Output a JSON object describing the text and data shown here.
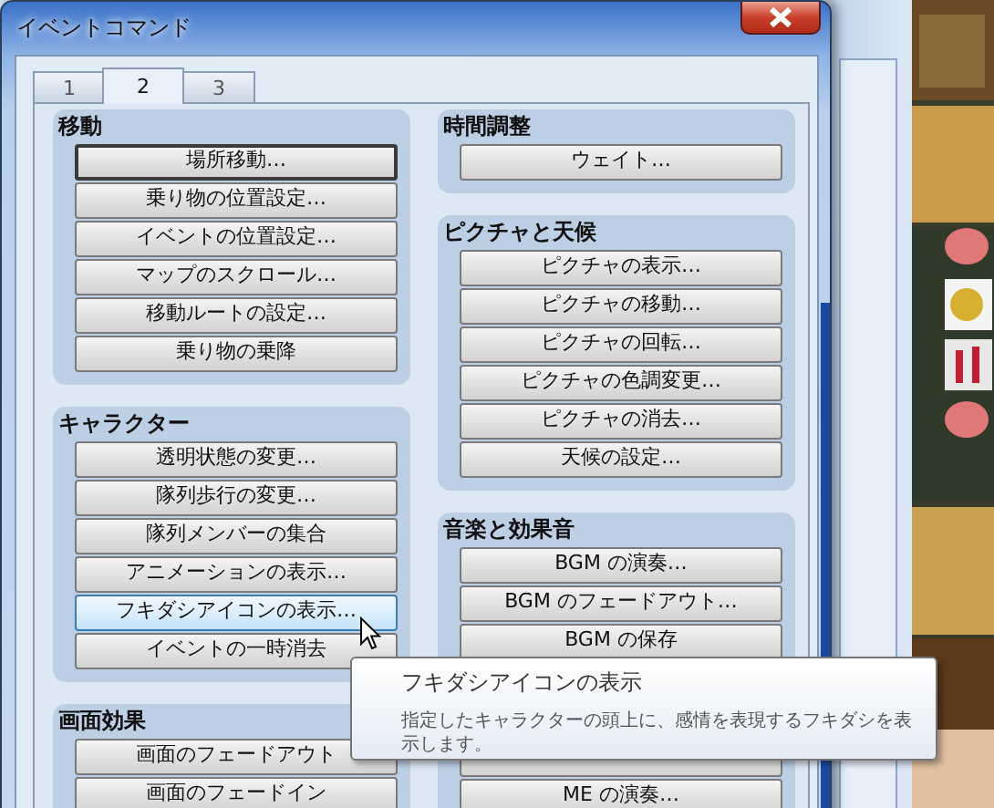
{
  "window": {
    "title": "イベントコマンド"
  },
  "tabs": [
    {
      "label": "1",
      "selected": false
    },
    {
      "label": "2",
      "selected": true
    },
    {
      "label": "3",
      "selected": false
    }
  ],
  "left_groups": [
    {
      "title": "移動",
      "buttons": [
        {
          "kind": "command",
          "label": "場所移動…",
          "focused": true,
          "hovered": false
        },
        {
          "kind": "command",
          "label": "乗り物の位置設定…",
          "focused": false,
          "hovered": false
        },
        {
          "kind": "command",
          "label": "イベントの位置設定…",
          "focused": false,
          "hovered": false
        },
        {
          "kind": "command",
          "label": "マップのスクロール…",
          "focused": false,
          "hovered": false
        },
        {
          "kind": "command",
          "label": "移動ルートの設定…",
          "focused": false,
          "hovered": false
        },
        {
          "kind": "command",
          "label": "乗り物の乗降",
          "focused": false,
          "hovered": false
        }
      ]
    },
    {
      "title": "キャラクター",
      "buttons": [
        {
          "kind": "command",
          "label": "透明状態の変更…",
          "focused": false,
          "hovered": false
        },
        {
          "kind": "command",
          "label": "隊列歩行の変更…",
          "focused": false,
          "hovered": false
        },
        {
          "kind": "command",
          "label": "隊列メンバーの集合",
          "focused": false,
          "hovered": false
        },
        {
          "kind": "command",
          "label": "アニメーションの表示…",
          "focused": false,
          "hovered": false
        },
        {
          "kind": "command",
          "label": "フキダシアイコンの表示…",
          "focused": false,
          "hovered": true
        },
        {
          "kind": "command",
          "label": "イベントの一時消去",
          "focused": false,
          "hovered": false
        }
      ]
    },
    {
      "title": "画面効果",
      "buttons": [
        {
          "kind": "command",
          "label": "画面のフェードアウト",
          "focused": false,
          "hovered": false
        },
        {
          "kind": "command",
          "label": "画面のフェードイン",
          "focused": false,
          "hovered": false
        }
      ]
    }
  ],
  "right_groups": [
    {
      "title": "時間調整",
      "buttons": [
        {
          "kind": "command",
          "label": "ウェイト…",
          "focused": false,
          "hovered": false
        }
      ]
    },
    {
      "title": "ピクチャと天候",
      "buttons": [
        {
          "kind": "command",
          "label": "ピクチャの表示…",
          "focused": false,
          "hovered": false
        },
        {
          "kind": "command",
          "label": "ピクチャの移動…",
          "focused": false,
          "hovered": false
        },
        {
          "kind": "command",
          "label": "ピクチャの回転…",
          "focused": false,
          "hovered": false
        },
        {
          "kind": "command",
          "label": "ピクチャの色調変更…",
          "focused": false,
          "hovered": false
        },
        {
          "kind": "command",
          "label": "ピクチャの消去…",
          "focused": false,
          "hovered": false
        },
        {
          "kind": "command",
          "label": "天候の設定…",
          "focused": false,
          "hovered": false
        }
      ]
    },
    {
      "title": "音楽と効果音",
      "buttons": [
        {
          "kind": "command",
          "label": "BGM の演奏…",
          "focused": false,
          "hovered": false
        },
        {
          "kind": "command",
          "label": "BGM のフェードアウト…",
          "focused": false,
          "hovered": false
        },
        {
          "kind": "command",
          "label": "BGM の保存",
          "focused": false,
          "hovered": false
        },
        {
          "kind": "covered",
          "focused": false,
          "hovered": false
        },
        {
          "kind": "command",
          "label": "ME の演奏…",
          "focused": false,
          "hovered": false
        }
      ]
    }
  ],
  "tooltip": {
    "title": "フキダシアイコンの表示",
    "text": "指定したキャラクターの頭上に、感情を表現するフキダシを表示します。"
  }
}
